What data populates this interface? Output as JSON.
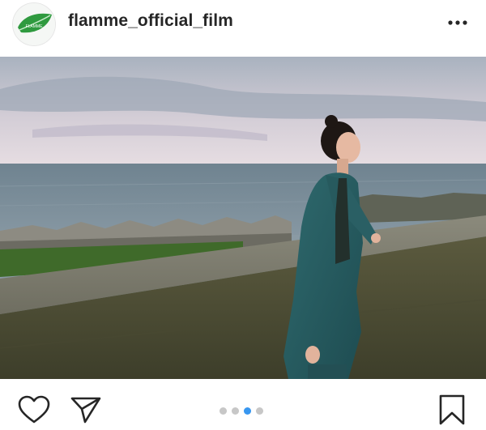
{
  "post": {
    "username": "flamme_official_film",
    "avatar_icon": "leaf-logo-icon",
    "avatar_text": "FLAMME",
    "more_icon": "more-options-icon"
  },
  "photo": {
    "icon": "photo-woman-teal-suit-seawall"
  },
  "actions": {
    "like_icon": "heart-icon",
    "share_icon": "paper-plane-icon",
    "save_icon": "bookmark-icon"
  },
  "carousel": {
    "total": 4,
    "active_index": 2,
    "active_color": "#3897f0",
    "inactive_color": "#c7c7c7"
  }
}
